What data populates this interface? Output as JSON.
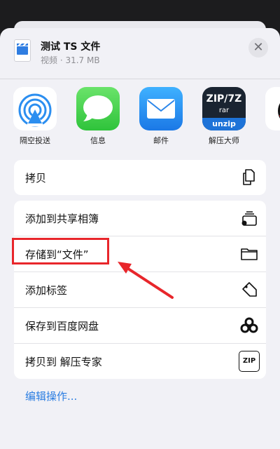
{
  "header": {
    "title": "测试 TS 文件",
    "subtitle": "视频 · 31.7 MB",
    "close_symbol": "✕"
  },
  "apps": [
    {
      "label": "隔空投送",
      "icon": "airdrop-icon"
    },
    {
      "label": "信息",
      "icon": "messages-icon"
    },
    {
      "label": "邮件",
      "icon": "mail-icon"
    },
    {
      "label": "解压大师",
      "icon": "unzip-master-icon",
      "icon_text_top": "ZIP/7Z",
      "icon_text_mid": "rar",
      "icon_text_bottom": "unzip"
    },
    {
      "label": "",
      "icon": "qq-icon"
    }
  ],
  "actions_group1": [
    {
      "label": "拷贝",
      "icon": "copy-icon"
    }
  ],
  "actions_group2": [
    {
      "label": "添加到共享相簿",
      "icon": "shared-album-icon"
    },
    {
      "label": "存储到“文件”",
      "icon": "folder-icon"
    },
    {
      "label": "添加标签",
      "icon": "tag-icon"
    },
    {
      "label": "保存到百度网盘",
      "icon": "baidu-netdisk-icon"
    },
    {
      "label": "拷贝到 解压专家",
      "icon": "zip-icon",
      "icon_text": "ZIP"
    }
  ],
  "edit_actions": "编辑操作...",
  "colors": {
    "accent": "#2a7de1",
    "annotation_red": "#e8262b",
    "sheet_background": "#f1f1f6"
  }
}
